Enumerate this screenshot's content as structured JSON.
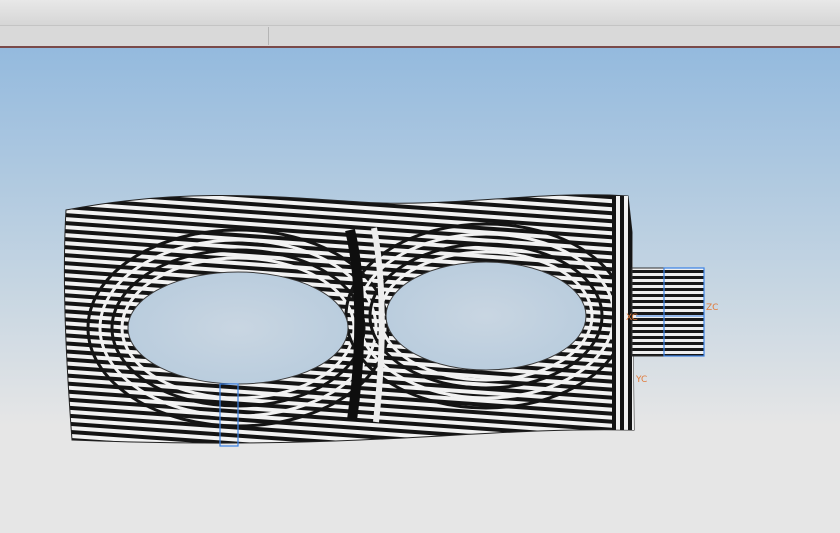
{
  "window": {
    "title": ""
  },
  "tabs": [
    {
      "label": ""
    },
    {
      "label": ""
    }
  ],
  "viewport": {
    "render_mode": "zebra-stripe-analysis",
    "background_top": "#94bade",
    "background_bottom": "#e6e6e6",
    "stripe_dark": "#141414",
    "stripe_light": "#f2f2f2",
    "csys_color": "#3b82e6",
    "axis_label_color": "#e07a3a",
    "axes": {
      "x": "XC",
      "y": "YC",
      "z": "ZC"
    }
  }
}
